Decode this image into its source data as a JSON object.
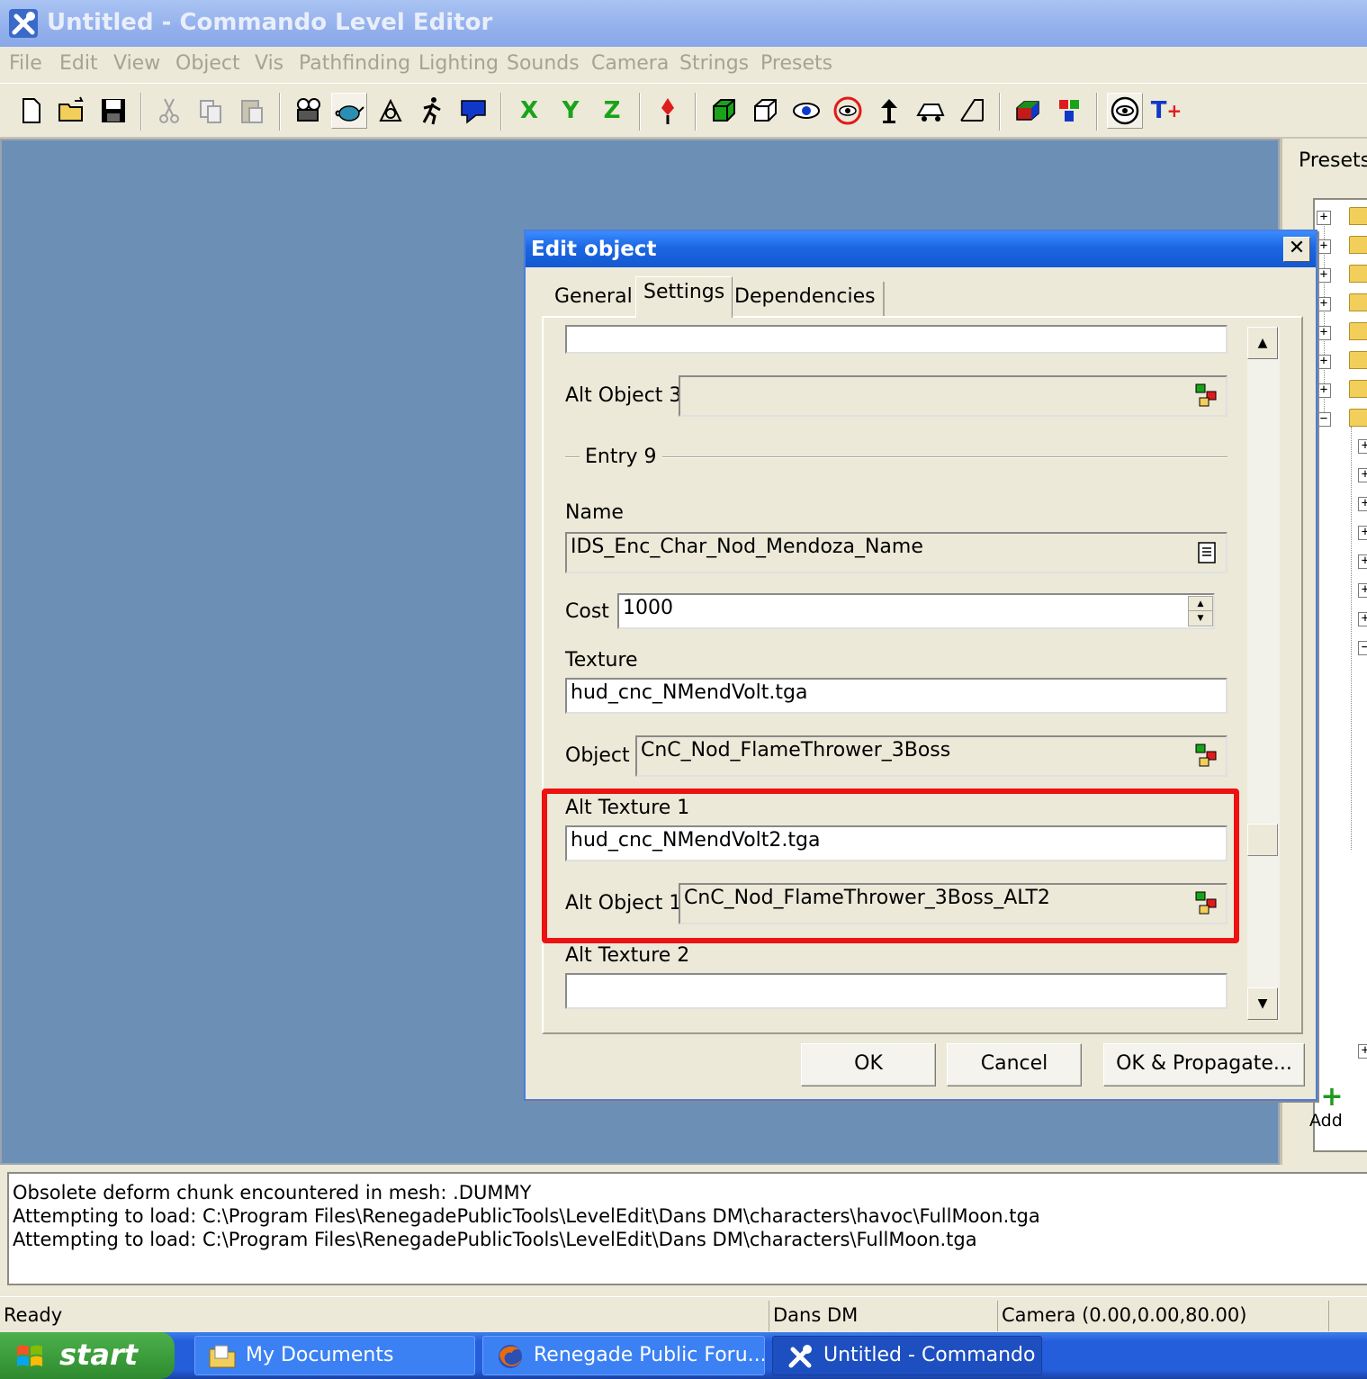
{
  "window": {
    "title": "Untitled - Commando Level Editor"
  },
  "menu": [
    "File",
    "Edit",
    "View",
    "Object",
    "Vis",
    "Pathfinding",
    "Lighting",
    "Sounds",
    "Camera",
    "Strings",
    "Presets"
  ],
  "toolbar": {
    "x": "X",
    "y": "Y",
    "z": "Z",
    "text_tool": "T"
  },
  "presets": {
    "title": "Presets",
    "add_label": "Add"
  },
  "dialog": {
    "title": "Edit object",
    "close": "✕",
    "tabs": [
      "General",
      "Settings",
      "Dependencies"
    ],
    "active_tab": "Settings",
    "alt_object_3_label": "Alt Object 3",
    "alt_object_3_value": "",
    "entry_label": "Entry 9",
    "name_label": "Name",
    "name_value": "IDS_Enc_Char_Nod_Mendoza_Name",
    "cost_label": "Cost",
    "cost_value": "1000",
    "texture_label": "Texture",
    "texture_value": "hud_cnc_NMendVolt.tga",
    "object_label": "Object",
    "object_value": "CnC_Nod_FlameThrower_3Boss",
    "alt_texture_1_label": "Alt Texture 1",
    "alt_texture_1_value": "hud_cnc_NMendVolt2.tga",
    "alt_object_1_label": "Alt Object 1",
    "alt_object_1_value": "CnC_Nod_FlameThrower_3Boss_ALT2",
    "alt_texture_2_label": "Alt Texture 2",
    "alt_texture_2_value": "",
    "ok_label": "OK",
    "cancel_label": "Cancel",
    "ok_propagate_label": "OK & Propagate...",
    "highlight_color": "#ee1111"
  },
  "log": [
    "Obsolete deform chunk encountered in mesh: .DUMMY",
    "Attempting to load: C:\\Program Files\\RenegadePublicTools\\LevelEdit\\Dans DM\\characters\\havoc\\FullMoon.tga",
    "Attempting to load: C:\\Program Files\\RenegadePublicTools\\LevelEdit\\Dans DM\\characters\\FullMoon.tga"
  ],
  "status": {
    "message": "Ready",
    "level": "Dans DM",
    "camera": "Camera (0.00,0.00,80.00)"
  },
  "taskbar": {
    "start": "start",
    "tasks": [
      "My Documents",
      "Renegade Public Foru...",
      "Untitled - Commando ..."
    ],
    "active_index": 2
  }
}
